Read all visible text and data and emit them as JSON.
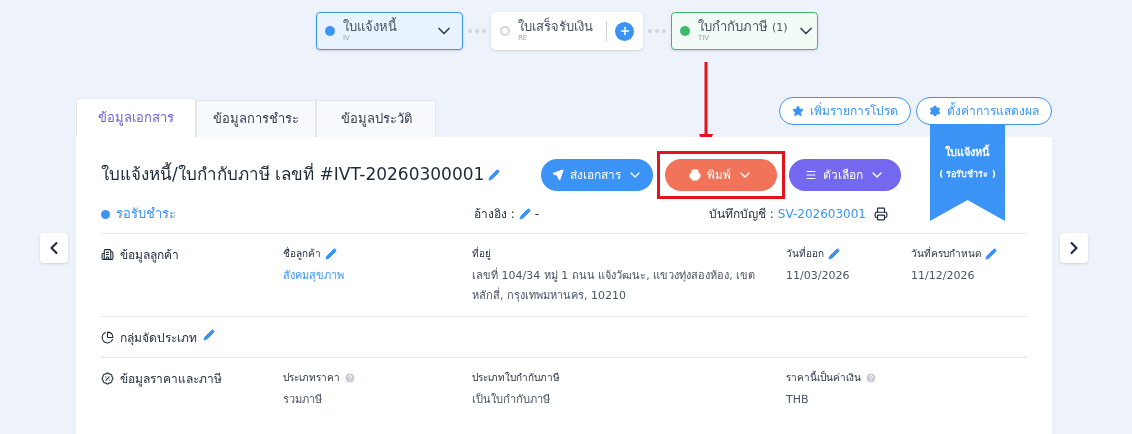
{
  "steps": [
    {
      "label": "ใบแจ้งหนี้",
      "code": "IV",
      "kind": "dropdown",
      "selected": true,
      "color": "#3b94f5"
    },
    {
      "label": "ใบเสร็จรับเงิน",
      "code": "RE",
      "kind": "add",
      "selected": false
    },
    {
      "label": "ใบกำกับภาษี",
      "count": "(1)",
      "code": "TIV",
      "kind": "dropdown",
      "selected": false,
      "color": "#3dbb6a"
    }
  ],
  "tabs": [
    {
      "label": "ข้อมูลเอกสาร",
      "selected": true
    },
    {
      "label": "ข้อมูลการชำระ",
      "selected": false
    },
    {
      "label": "ข้อมูลประวัติ",
      "selected": false
    }
  ],
  "actions": [
    {
      "label": "เพิ่มรายการโปรด"
    },
    {
      "label": "ตั้งค่าการแสดงผล"
    }
  ],
  "ribbon": {
    "title": "ใบแจ้งหนี้",
    "status": "( รอรับชำระ )"
  },
  "document": {
    "title": "ใบแจ้งหนี้/ใบกำกับภาษี เลขที่ #IVT-20260300001",
    "buttons": [
      {
        "label": "ส่งเอกสาร",
        "color": "#3b94f5",
        "highlighted": false
      },
      {
        "label": "พิมพ์",
        "color": "#f0735a",
        "highlighted": true
      },
      {
        "label": "ตัวเลือก",
        "color": "#7468ee",
        "highlighted": false
      }
    ],
    "status": "รอรับชำระ",
    "reference_label": "อ้างอิง :",
    "reference_value": "-",
    "account_label": "บันทึกบัญชี :",
    "account_value": "SV-202603001"
  },
  "sections": [
    {
      "title": "ข้อมูลลูกค้า",
      "editable": false,
      "fields": [
        {
          "label": "ชื่อลูกค้า",
          "editable": true,
          "help": false,
          "value": "สังคมสุขภาพ",
          "link": true
        },
        {
          "label": "ที่อยู่",
          "editable": false,
          "help": false,
          "value": "เลขที่ 104/34 หมู่ 1 ถนน แจ้งวัฒนะ, แขวงทุ่งสองห้อง, เขตหลักสี่, กรุงเทพมหานคร, 10210",
          "link": false
        },
        {
          "label": "วันที่ออก",
          "editable": true,
          "help": false,
          "value": "11/03/2026",
          "link": false
        },
        {
          "label": "วันที่ครบกำหนด",
          "editable": true,
          "help": false,
          "value": "11/12/2026",
          "link": false
        }
      ]
    },
    {
      "title": "กลุ่มจัดประเภท",
      "editable": true
    },
    {
      "title": "ข้อมูลราคาและภาษี",
      "editable": false,
      "fields": [
        {
          "label": "ประเภทราคา",
          "editable": false,
          "help": true,
          "value": "รวมภาษี",
          "link": false
        },
        {
          "label": "ประเภทใบกำกับภาษี",
          "editable": false,
          "help": false,
          "value": "เป็นใบกำกับภาษี",
          "link": false
        },
        {
          "label": "ราคานี้เป็นค่าเงิน",
          "editable": false,
          "help": true,
          "value": "THB",
          "link": false
        }
      ]
    }
  ]
}
